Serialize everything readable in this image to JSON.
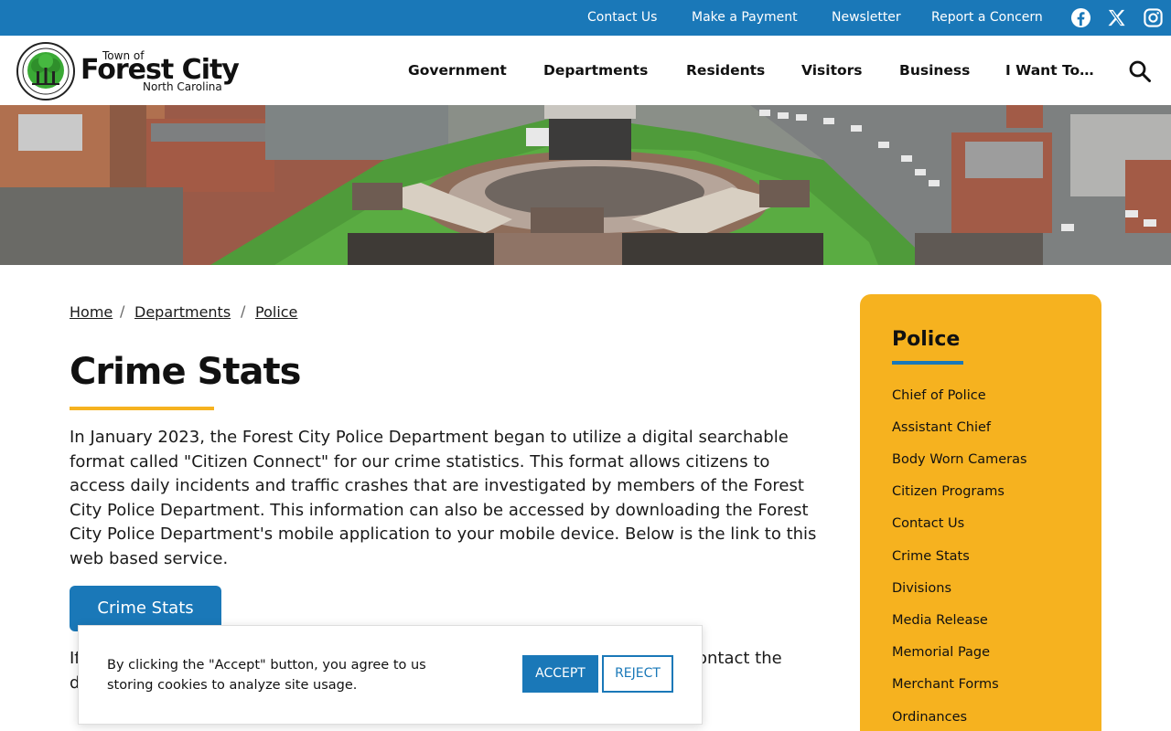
{
  "topbar": {
    "links": [
      "Contact Us",
      "Make a Payment",
      "Newsletter",
      "Report a Concern"
    ],
    "social_icons": [
      "facebook-icon",
      "x-icon",
      "instagram-icon"
    ],
    "color": "#1a78b8"
  },
  "logo": {
    "small": "Town of",
    "name": "Forest City",
    "state": "North Carolina"
  },
  "nav": {
    "items": [
      "Government",
      "Departments",
      "Residents",
      "Visitors",
      "Business",
      "I Want To…"
    ],
    "search_icon": "search-icon"
  },
  "breadcrumb": [
    "Home",
    "Departments",
    "Police"
  ],
  "page": {
    "title": "Crime Stats",
    "intro_lines": [
      "In January 2023, the Forest City Police Department began to utilize a digital searchable",
      "format called \"Citizen Connect\" for our crime statistics. This format allows citizens to",
      "access daily incidents and traffic crashes that are investigated by members of the Forest",
      "City Police Department. This information can also be accessed by downloading the Forest",
      "City Police Department's mobile application to your mobile device. Below is the link to this",
      "web based service."
    ],
    "button_label": "Crime Stats",
    "para2_start": "If",
    "para2_end": "ontact the",
    "para2_line2": "d"
  },
  "sidebar": {
    "title": "Police",
    "links": [
      "Chief of Police",
      "Assistant Chief",
      "Body Worn Cameras",
      "Citizen Programs",
      "Contact Us",
      "Crime Stats",
      "Divisions",
      "Media Release",
      "Memorial Page",
      "Merchant Forms",
      "Ordinances"
    ],
    "color": "#f6b21f"
  },
  "cookie": {
    "text_lines": [
      "By clicking the \"Accept\" button, you agree to us",
      "storing cookies to analyze site usage."
    ],
    "accept": "ACCEPT",
    "reject": "REJECT"
  }
}
